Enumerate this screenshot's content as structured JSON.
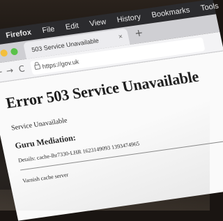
{
  "menubar": {
    "apple_icon": "apple-icon",
    "app_name": "Firefox",
    "items": [
      "File",
      "Edit",
      "View",
      "History",
      "Bookmarks",
      "Tools"
    ]
  },
  "tab": {
    "title": "503 Service Unavailable",
    "close_icon": "×"
  },
  "toolbar": {
    "new_tab": "+",
    "back_icon": "←",
    "forward_icon": "→",
    "reload_icon": "C",
    "url": "https://gov.uk"
  },
  "page": {
    "title": "Error 503 Service Unavailable",
    "status": "Service Unavailable",
    "guru_heading": "Guru Mediation:",
    "details": "Details: cache-lhr7330-LHR 1623149093 1393474965",
    "footer": "Varnish cache server"
  },
  "colors": {
    "traffic_red": "#ee5b52",
    "traffic_yellow": "#f3bf3c",
    "traffic_green": "#5ac249"
  }
}
